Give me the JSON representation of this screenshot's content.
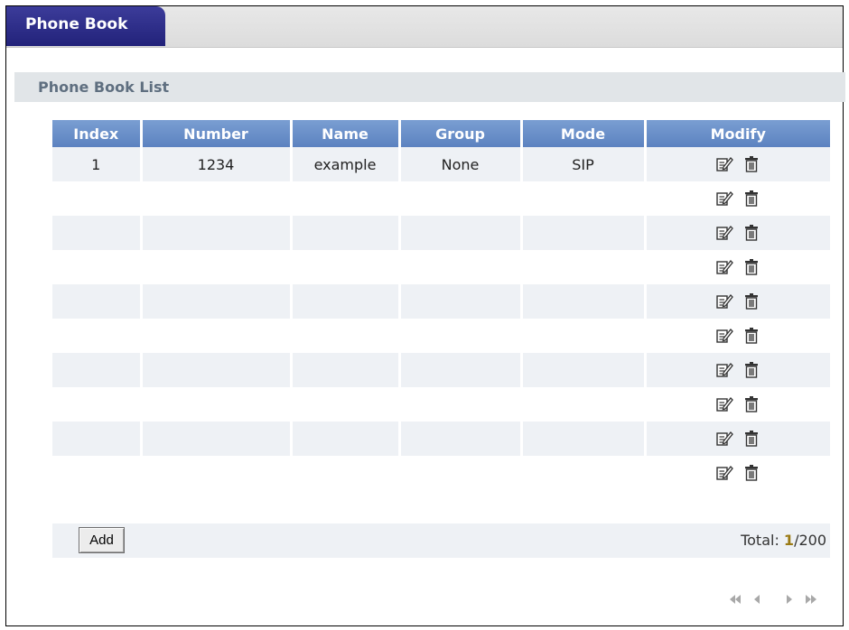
{
  "tab": {
    "label": "Phone Book"
  },
  "section": {
    "title": "Phone Book List"
  },
  "table": {
    "columns": [
      "Index",
      "Number",
      "Name",
      "Group",
      "Mode",
      "Modify"
    ],
    "rows": [
      [
        "1",
        "1234",
        "example",
        "None",
        "SIP"
      ],
      [
        "",
        "",
        "",
        "",
        ""
      ],
      [
        "",
        "",
        "",
        "",
        ""
      ],
      [
        "",
        "",
        "",
        "",
        ""
      ],
      [
        "",
        "",
        "",
        "",
        ""
      ],
      [
        "",
        "",
        "",
        "",
        ""
      ],
      [
        "",
        "",
        "",
        "",
        ""
      ],
      [
        "",
        "",
        "",
        "",
        ""
      ],
      [
        "",
        "",
        "",
        "",
        ""
      ],
      [
        "",
        "",
        "",
        "",
        ""
      ]
    ]
  },
  "footer": {
    "add_label": "Add",
    "total_prefix": "Total: ",
    "total_current": "1",
    "total_suffix": "/200"
  },
  "pager": {
    "icons": [
      "first-page-icon",
      "previous-page-icon",
      "next-page-icon",
      "last-page-icon"
    ]
  },
  "colors": {
    "tab": "#2a2a82",
    "header": "#6a90cc",
    "row_alt": "#eef1f5",
    "section": "#e1e5e8"
  },
  "icons": {
    "edit": "edit-icon",
    "delete": "delete-icon"
  }
}
